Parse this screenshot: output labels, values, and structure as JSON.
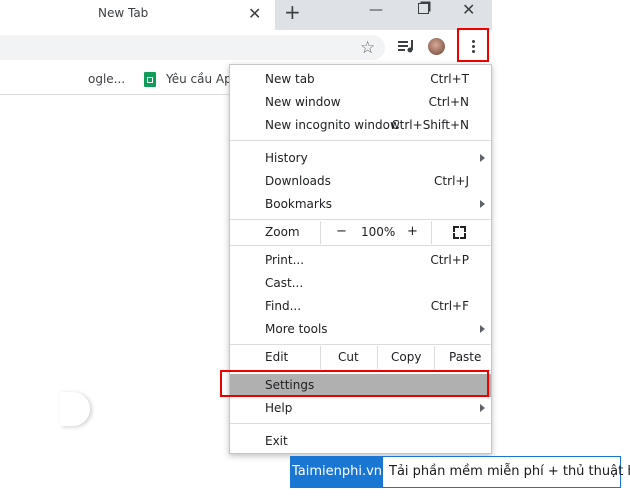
{
  "tab": {
    "title": "New Tab",
    "close_glyph": "✕",
    "new_tab_glyph": "+"
  },
  "window": {
    "minimize_glyph": "—",
    "close_glyph": "✕"
  },
  "toolbar": {
    "star_glyph": "☆"
  },
  "bookmarks": {
    "google_label": "ogle...",
    "sheets_label": "Yêu cầu App"
  },
  "menu": {
    "items": [
      {
        "label": "New tab",
        "shortcut": "Ctrl+T"
      },
      {
        "label": "New window",
        "shortcut": "Ctrl+N"
      },
      {
        "label": "New incognito window",
        "shortcut": "Ctrl+Shift+N"
      },
      {
        "label": "History",
        "shortcut": ""
      },
      {
        "label": "Downloads",
        "shortcut": "Ctrl+J"
      },
      {
        "label": "Bookmarks",
        "shortcut": ""
      },
      {
        "label": "Print...",
        "shortcut": "Ctrl+P"
      },
      {
        "label": "Cast...",
        "shortcut": ""
      },
      {
        "label": "Find...",
        "shortcut": "Ctrl+F"
      },
      {
        "label": "More tools",
        "shortcut": ""
      },
      {
        "label": "Settings",
        "shortcut": ""
      },
      {
        "label": "Help",
        "shortcut": ""
      },
      {
        "label": "Exit",
        "shortcut": ""
      }
    ],
    "zoom": {
      "label": "Zoom",
      "minus": "−",
      "value": "100%",
      "plus": "+"
    },
    "edit": {
      "label": "Edit",
      "cut": "Cut",
      "copy": "Copy",
      "paste": "Paste"
    }
  },
  "watermark": {
    "brand": "Taimienphi.vn",
    "tagline": "Tải phần mềm miễn phí + thủ thuật hay"
  },
  "colors": {
    "highlight": "#ee0000",
    "accent": "#1976d2",
    "selected_row": "#b0b0b0"
  }
}
